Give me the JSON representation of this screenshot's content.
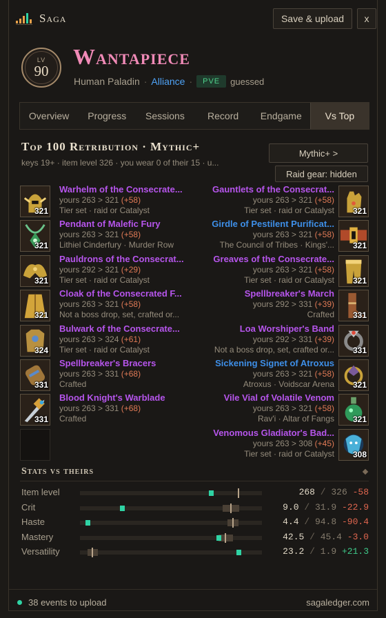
{
  "app": {
    "title": "Saga",
    "save_label": "Save & upload",
    "close_label": "x"
  },
  "profile": {
    "level_label": "LV",
    "level": "90",
    "name": "Wantapiece",
    "race_class": "Human Paladin",
    "faction": "Alliance",
    "mode": "PVE",
    "mode_note": "guessed"
  },
  "tabs": [
    {
      "label": "Overview"
    },
    {
      "label": "Progress"
    },
    {
      "label": "Sessions"
    },
    {
      "label": "Record"
    },
    {
      "label": "Endgame"
    },
    {
      "label": "Vs Top",
      "active": true
    }
  ],
  "section": {
    "title": "Top 100 Retribution · Mythic+",
    "subtitle": "keys 19+ · item level 326 · you wear 0 of their 15 · u...",
    "mythic_button": "Mythic+ >",
    "raid_button": "Raid gear: hidden"
  },
  "gear": {
    "left": [
      {
        "name": "Warhelm of the Consecrate...",
        "quality": "epic",
        "compare": "yours 263 > 321",
        "delta": "(+58)",
        "source": "Tier set · raid or Catalyst",
        "ilvl": "321",
        "icon": "helm-icon",
        "color": "#c9a23a"
      },
      {
        "name": "Pendant of Malefic Fury",
        "quality": "epic",
        "compare": "yours 263 > 321",
        "delta": "(+58)",
        "source": "Lithiel Cinderfury · Murder Row",
        "ilvl": "321",
        "icon": "pendant-icon",
        "color": "#3a9a5a"
      },
      {
        "name": "Pauldrons of the Consecrat...",
        "quality": "epic",
        "compare": "yours 292 > 321",
        "delta": "(+29)",
        "source": "Tier set · raid or Catalyst",
        "ilvl": "321",
        "icon": "shoulder-icon",
        "color": "#c9a23a"
      },
      {
        "name": "Cloak of the Consecrated F...",
        "quality": "epic",
        "compare": "yours 263 > 321",
        "delta": "(+58)",
        "source": "Not a boss drop, set, crafted or...",
        "ilvl": "321",
        "icon": "cloak-icon",
        "color": "#d2a43a"
      },
      {
        "name": "Bulwark of the Consecrate...",
        "quality": "epic",
        "compare": "yours 263 > 324",
        "delta": "(+61)",
        "source": "Tier set · raid or Catalyst",
        "ilvl": "324",
        "icon": "chest-icon",
        "color": "#b89040"
      },
      {
        "name": "Spellbreaker's Bracers",
        "quality": "epic",
        "compare": "yours 263 > 331",
        "delta": "(+68)",
        "source": "Crafted",
        "ilvl": "331",
        "icon": "bracer-icon",
        "color": "#a0763a"
      },
      {
        "name": "Blood Knight's Warblade",
        "quality": "epic",
        "compare": "yours 263 > 331",
        "delta": "(+68)",
        "source": "Crafted",
        "ilvl": "331",
        "icon": "sword-icon",
        "color": "#d7a03a"
      }
    ],
    "right": [
      {
        "name": "Gauntlets of the Consecrat...",
        "quality": "epic",
        "compare": "yours 263 > 321",
        "delta": "(+58)",
        "source": "Tier set · raid or Catalyst",
        "ilvl": "321",
        "icon": "gauntlet-icon",
        "color": "#c9a23a"
      },
      {
        "name": "Girdle of Pestilent Purificat...",
        "quality": "rare",
        "compare": "yours 263 > 321",
        "delta": "(+58)",
        "source": "The Council of Tribes · Kings'...",
        "ilvl": "321",
        "icon": "belt-icon",
        "color": "#b04a2a"
      },
      {
        "name": "Greaves of the Consecrate...",
        "quality": "epic",
        "compare": "yours 263 > 321",
        "delta": "(+58)",
        "source": "Tier set · raid or Catalyst",
        "ilvl": "321",
        "icon": "legs-icon",
        "color": "#c9a23a"
      },
      {
        "name": "Spellbreaker's March",
        "quality": "epic",
        "compare": "yours 292 > 331",
        "delta": "(+39)",
        "source": "Crafted",
        "ilvl": "331",
        "icon": "boots-icon",
        "color": "#9a5a32"
      },
      {
        "name": "Loa Worshiper's Band",
        "quality": "epic",
        "compare": "yours 292 > 331",
        "delta": "(+39)",
        "source": "Not a boss drop, set, crafted or...",
        "ilvl": "331",
        "icon": "ring-icon",
        "color": "#8a8a8a"
      },
      {
        "name": "Sickening Signet of Atroxus",
        "quality": "rare",
        "compare": "yours 263 > 321",
        "delta": "(+58)",
        "source": "Atroxus · Voidscar Arena",
        "ilvl": "321",
        "icon": "signet-icon",
        "color": "#7a5a9a"
      },
      {
        "name": "Vile Vial of Volatile Venom",
        "quality": "epic",
        "compare": "yours 263 > 321",
        "delta": "(+58)",
        "source": "Rav'i · Altar of Fangs",
        "ilvl": "321",
        "icon": "vial-icon",
        "color": "#2f9a5a"
      },
      {
        "name": "Venomous Gladiator's Bad...",
        "quality": "epic",
        "compare": "yours 263 > 308",
        "delta": "(+45)",
        "source": "Tier set · raid or Catalyst",
        "ilvl": "308",
        "icon": "badge-icon",
        "color": "#4ab0d8"
      }
    ]
  },
  "stats": {
    "title": "Stats vs theirs",
    "rows": [
      {
        "label": "Item level",
        "yours": "268",
        "theirs": "326",
        "delta": "-58",
        "sign": "neg",
        "yours_frac": 0.72,
        "theirs_frac": 0.87,
        "band_frac": 0.0
      },
      {
        "label": "Crit",
        "yours": "9.0",
        "theirs": "31.9",
        "delta": "-22.9",
        "sign": "neg",
        "yours_frac": 0.23,
        "theirs_frac": 0.83,
        "band_frac": 0.09
      },
      {
        "label": "Haste",
        "yours": "4.4",
        "theirs": "94.8",
        "delta": "-90.4",
        "sign": "neg",
        "yours_frac": 0.04,
        "theirs_frac": 0.84,
        "band_frac": 0.06
      },
      {
        "label": "Mastery",
        "yours": "42.5",
        "theirs": "45.4",
        "delta": "-3.0",
        "sign": "neg",
        "yours_frac": 0.76,
        "theirs_frac": 0.8,
        "band_frac": 0.08
      },
      {
        "label": "Versatility",
        "yours": "23.2",
        "theirs": "1.9",
        "delta": "+21.3",
        "sign": "pos",
        "yours_frac": 0.87,
        "theirs_frac": 0.07,
        "band_frac": 0.06
      }
    ]
  },
  "footer": {
    "status": "38 events to upload",
    "link": "sagaledger.com"
  }
}
